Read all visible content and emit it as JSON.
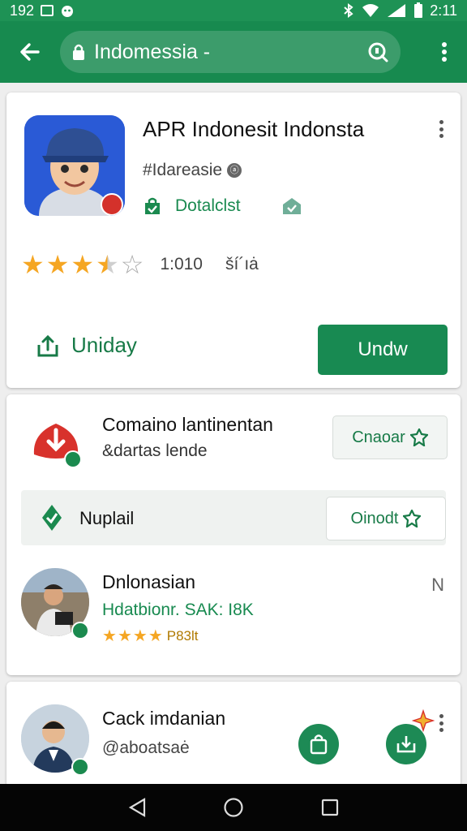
{
  "status_bar": {
    "left_text": "192",
    "time": "2:11"
  },
  "url_bar": {
    "text": "Indomessia -"
  },
  "app": {
    "title": "APR Indonesit Indonsta",
    "developer": "#Idareasie",
    "developer_badge": "ⓐ",
    "badge_label": "Dotalclst",
    "rating_count": "1:010",
    "rating_extra": "ší´ıȧ",
    "stars_filled": 3.5,
    "stars_total": 5,
    "share_label": "Uniday",
    "install_label": "Undw"
  },
  "promo": {
    "title": "Comaino lantinentan",
    "subtitle": "&dartas lende",
    "button_label": "Cnaoar"
  },
  "nuplail": {
    "label": "Nuplail",
    "button_label": "Oinodt"
  },
  "list_items": [
    {
      "title": "Dnlonasian",
      "subtitle": "Hdatbionr. SAK: I8K",
      "stars_filled": 4,
      "rating_text": "P83lt",
      "meta": "N"
    },
    {
      "title": "Cack imdanian",
      "subtitle": "@aboatsaė",
      "stars_filled": 0,
      "rating_text": "",
      "meta": ""
    }
  ],
  "colors": {
    "brand_green": "#178a4f",
    "star": "#f5a623",
    "promo_red": "#d8322c"
  },
  "icons": [
    "back-arrow-icon",
    "lock-icon",
    "search-icon",
    "more-vert-icon",
    "share-icon",
    "verified-icon",
    "shield-icon",
    "star-icon",
    "store-icon",
    "download-icon"
  ]
}
